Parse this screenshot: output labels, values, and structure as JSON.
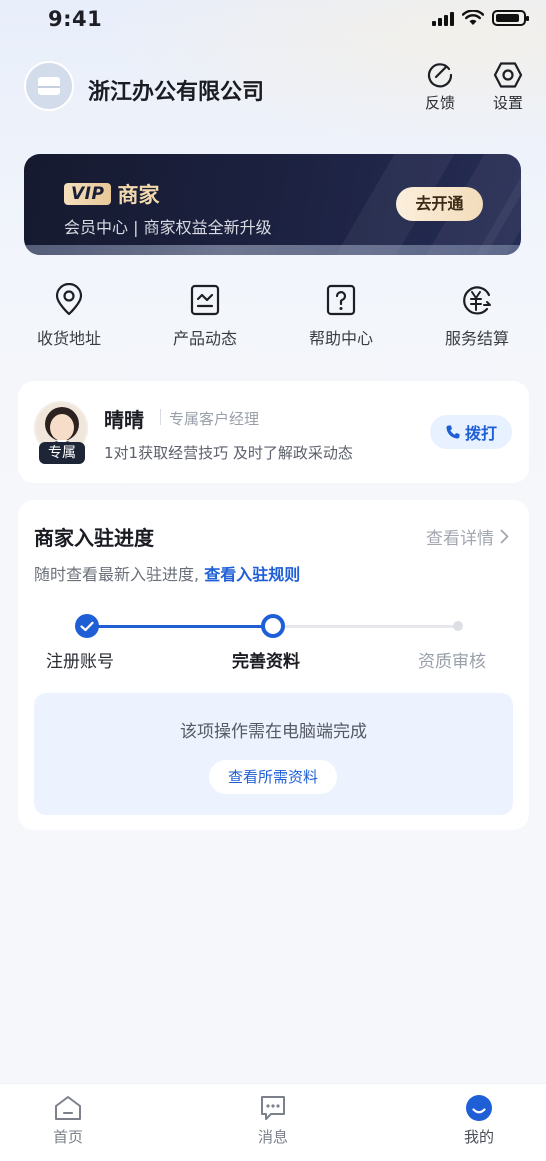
{
  "status_bar": {
    "time": "9:41",
    "battery_level": 0.9,
    "signal_bars": 4
  },
  "header": {
    "company_name": "浙江办公有限公司",
    "feedback_label": "反馈",
    "settings_label": "设置"
  },
  "vip_banner": {
    "tag": "VIP",
    "title": "商家",
    "subtitle": "会员中心 | 商家权益全新升级",
    "button_label": "去开通"
  },
  "quick_menu": [
    {
      "label": "收货地址",
      "icon": "location-pin-icon"
    },
    {
      "label": "产品动态",
      "icon": "trend-chart-icon"
    },
    {
      "label": "帮助中心",
      "icon": "help-question-icon"
    },
    {
      "label": "服务结算",
      "icon": "yuan-settlement-icon"
    }
  ],
  "manager": {
    "name": "晴晴",
    "role": "专属客户经理",
    "tag": "专属",
    "description": "1对1获取经营技巧  及时了解政采动态",
    "call_label": "拨打"
  },
  "progress": {
    "title": "商家入驻进度",
    "detail_link": "查看详情",
    "subtitle_prefix": "随时查看最新入驻进度,",
    "subtitle_link": "查看入驻规则",
    "steps": [
      {
        "label": "注册账号",
        "state": "done"
      },
      {
        "label": "完善资料",
        "state": "current"
      },
      {
        "label": "资质审核",
        "state": "todo"
      }
    ],
    "notice": "该项操作需在电脑端完成",
    "notice_button": "查看所需资料"
  },
  "tab_bar": {
    "items": [
      {
        "label": "首页",
        "icon": "home-icon"
      },
      {
        "label": "消息",
        "icon": "message-icon"
      },
      {
        "label": "我的",
        "icon": "profile-smile-icon",
        "active": true
      }
    ]
  },
  "colors": {
    "accent": "#1f5fd6",
    "vip_dark": "#161a2f",
    "vip_gold": "#f2d9ae"
  }
}
